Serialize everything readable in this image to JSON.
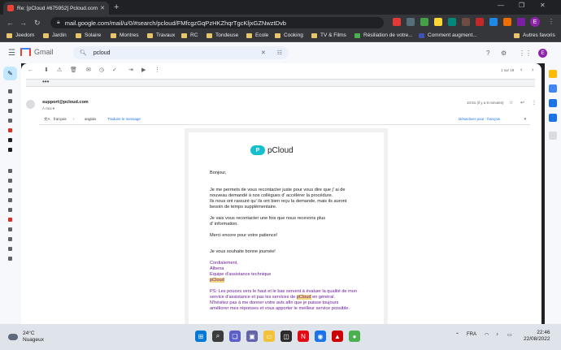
{
  "browser": {
    "tab_title": "Re: [pCloud #675952] Pcloud.com",
    "url": "mail.google.com/mail/u/0/#search/pcloud/FMfcgzGqPzHKZhqrTgcKljxGZNwztDvb",
    "profile_initial": "E",
    "bookmarks": [
      "Jeedom",
      "Jardin",
      "Solaire",
      "Montres",
      "Travaux",
      "RC",
      "Tondeuse",
      "Ecole",
      "Cooking",
      "TV & Films",
      "Résiliation de votre...",
      "Comment augment...",
      "Autres favoris"
    ]
  },
  "gmail": {
    "product_name": "Gmail",
    "search_query": "pcloud",
    "account_initial": "E",
    "pager": "1 sur 19",
    "collapsed_dots": "•••"
  },
  "message": {
    "sender": "support@pcloud.com",
    "recipient": "À moi ▾",
    "time": "10:51 (il y a 8 minutes)",
    "translate": {
      "from_lang": "français",
      "arrow": "›",
      "to_lang": "anglais",
      "action": "Traduire le message",
      "disable": "Désactiver pour : français"
    }
  },
  "email": {
    "brand": "pCloud",
    "brand_mark": "P",
    "greeting": "Bonjour,",
    "para1_l1": "Je me permets de vous recontacter juste pour vous dire que j' ai de",
    "para1_l2": "nouveau demandé à nos collègues d' accélérer la procédure.",
    "para1_l3": "Ils nous ont rassuré qu' ils ont bien reçu la demande, mais ils auront",
    "para1_l4": "besoin de temps supplémentaire.",
    "para2_l1": "Je vais vous recontacter une fois que nous recevons plus",
    "para2_l2": "d' information.",
    "thanks": "Merci encore pour votre patience!",
    "wish": "Je vous souhaite bonne journée!",
    "sig_l1": "Cordialement,",
    "sig_l2": "Albena",
    "sig_l3": "Equipe d'assistance technique",
    "sig_l4": "pCloud",
    "ps_l1": "PS: Les pouces vers le haut et le bas servent à évaluer la qualité de mon",
    "ps_l2a": "service d'assistance et pas les services de ",
    "ps_l2b": "pCloud",
    "ps_l2c": " en général.",
    "ps_l3": "N'hésitez pas à me donner votre avis afin que je puisse toujours",
    "ps_l4": "améliorer mes réponses et vous apporter le meilleur service possible."
  },
  "taskbar": {
    "temperature": "24°C",
    "weather": "Nuageux",
    "language": "FRA",
    "time": "22:46",
    "date": "22/08/2022"
  },
  "colors": {
    "accent": "#1a73e8",
    "signature": "#6a1b9a",
    "highlight": "#f5d77a",
    "brand": "#17bed0"
  }
}
